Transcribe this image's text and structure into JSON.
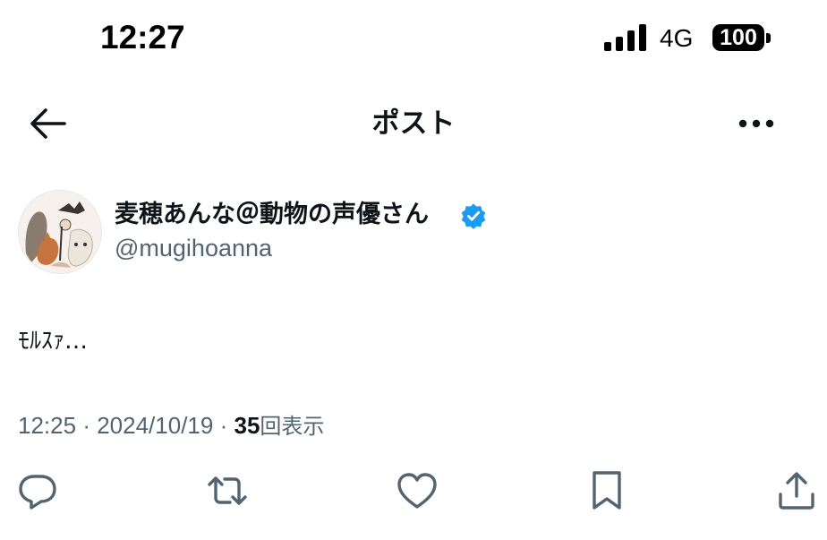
{
  "status_bar": {
    "time": "12:27",
    "network": "4G",
    "battery": "100"
  },
  "header": {
    "title": "ポスト",
    "back_icon": "arrow-left-icon",
    "more_icon": "more-horizontal-icon"
  },
  "author": {
    "display_name": "麦穂あんな＠動物の声優さん",
    "handle": "@mugihoanna",
    "verified": true
  },
  "post": {
    "text": "ﾓﾙｽｧ…"
  },
  "meta": {
    "time": "12:25",
    "separator": "·",
    "date": "2024/10/19",
    "views_count": "35",
    "views_label": "回表示"
  },
  "actions": [
    {
      "icon": "reply-icon"
    },
    {
      "icon": "repost-icon"
    },
    {
      "icon": "like-icon"
    },
    {
      "icon": "bookmark-icon"
    },
    {
      "icon": "share-icon"
    }
  ],
  "colors": {
    "text_primary": "#0f1419",
    "text_secondary": "#536471",
    "verified_blue": "#1d9bf0"
  }
}
